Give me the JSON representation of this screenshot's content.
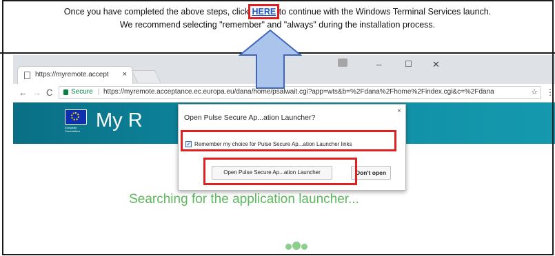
{
  "instructions": {
    "line1_before": "Once you have completed the above steps, click ",
    "line1_link": "HERE",
    "line1_after": " to continue with the Windows Terminal Services launch.",
    "line2": "We recommend selecting \"remember\" and \"always\" during the installation process."
  },
  "browser": {
    "tab_title": "https://myremote.accept",
    "tab_close": "×",
    "nav_back": "←",
    "nav_forward": "→",
    "nav_reload": "C",
    "secure_label": "Secure",
    "url": "https://myremote.acceptance.ec.europa.eu/dana/home/psalwait.cgi?app=wts&b=%2Fdana%2Fhome%2Findex.cgi&c=%2Fdana",
    "star": "☆",
    "menu": "⋮",
    "win_minimize": "–",
    "win_maximize": "☐",
    "win_close": "✕"
  },
  "site": {
    "eu_logo_text": "European Commission",
    "brand_title": "My R",
    "searching_text": "Searching for the application launcher..."
  },
  "dialog": {
    "title": "Open Pulse Secure Ap...ation Launcher?",
    "close": "×",
    "remember_label": "Remember my choice for Pulse Secure Ap...ation Launcher links",
    "remember_checked": true,
    "open_button": "Open Pulse Secure Ap...ation Launcher",
    "dont_open_button": "Don't open"
  },
  "colors": {
    "highlight": "#e02020",
    "link": "#1a57c9",
    "header_teal": "#0e8aa1",
    "searching_green": "#5cb85c",
    "arrow_fill": "#aac4ec",
    "arrow_stroke": "#3f67b8"
  }
}
